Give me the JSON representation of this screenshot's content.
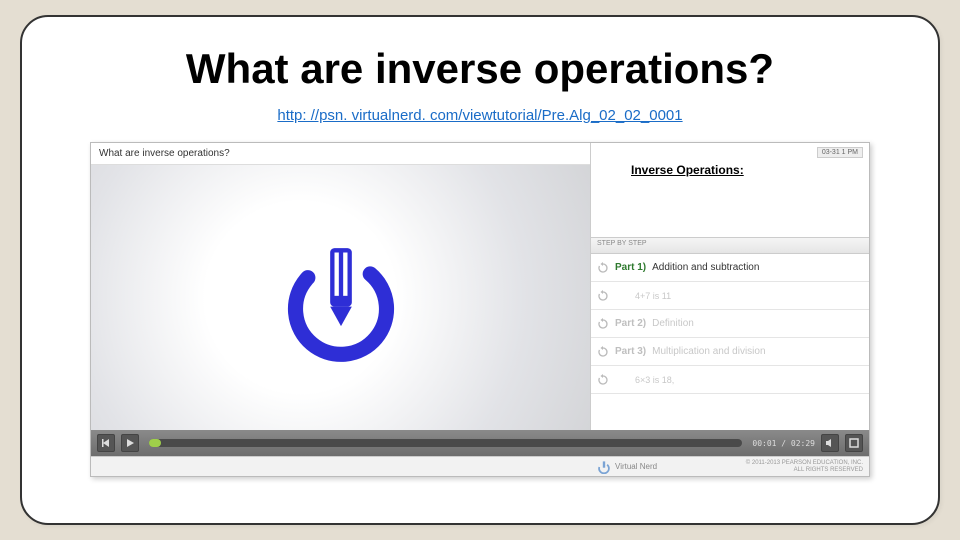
{
  "slide": {
    "title": "What are inverse operations?",
    "link_text": "http: //psn. virtualnerd. com/viewtutorial/Pre.Alg_02_02_0001",
    "link_href": "http://psn.virtualnerd.com/viewtutorial/Pre.Alg_02_02_0001"
  },
  "player": {
    "video_header": "What are inverse operations?",
    "concept_badge": "03-31 1 PM",
    "concept_title": "Inverse Operations:",
    "steps_header": "STEP BY STEP",
    "time": "00:01 / 02:29",
    "brand": "Virtual Nerd",
    "copyright_line1": "© 2011-2013 PEARSON EDUCATION, INC.",
    "copyright_line2": "ALL RIGHTS RESERVED",
    "steps": [
      {
        "part": "Part 1)",
        "desc": "Addition and subtraction",
        "cls": "active"
      },
      {
        "part": "",
        "desc": "4+7 is 11",
        "cls": "substep dim"
      },
      {
        "part": "Part 2)",
        "desc": "Definition",
        "cls": "dim"
      },
      {
        "part": "Part 3)",
        "desc": "Multiplication and division",
        "cls": "dim"
      },
      {
        "part": "",
        "desc": "6×3 is 18,",
        "cls": "substep dim"
      }
    ]
  }
}
